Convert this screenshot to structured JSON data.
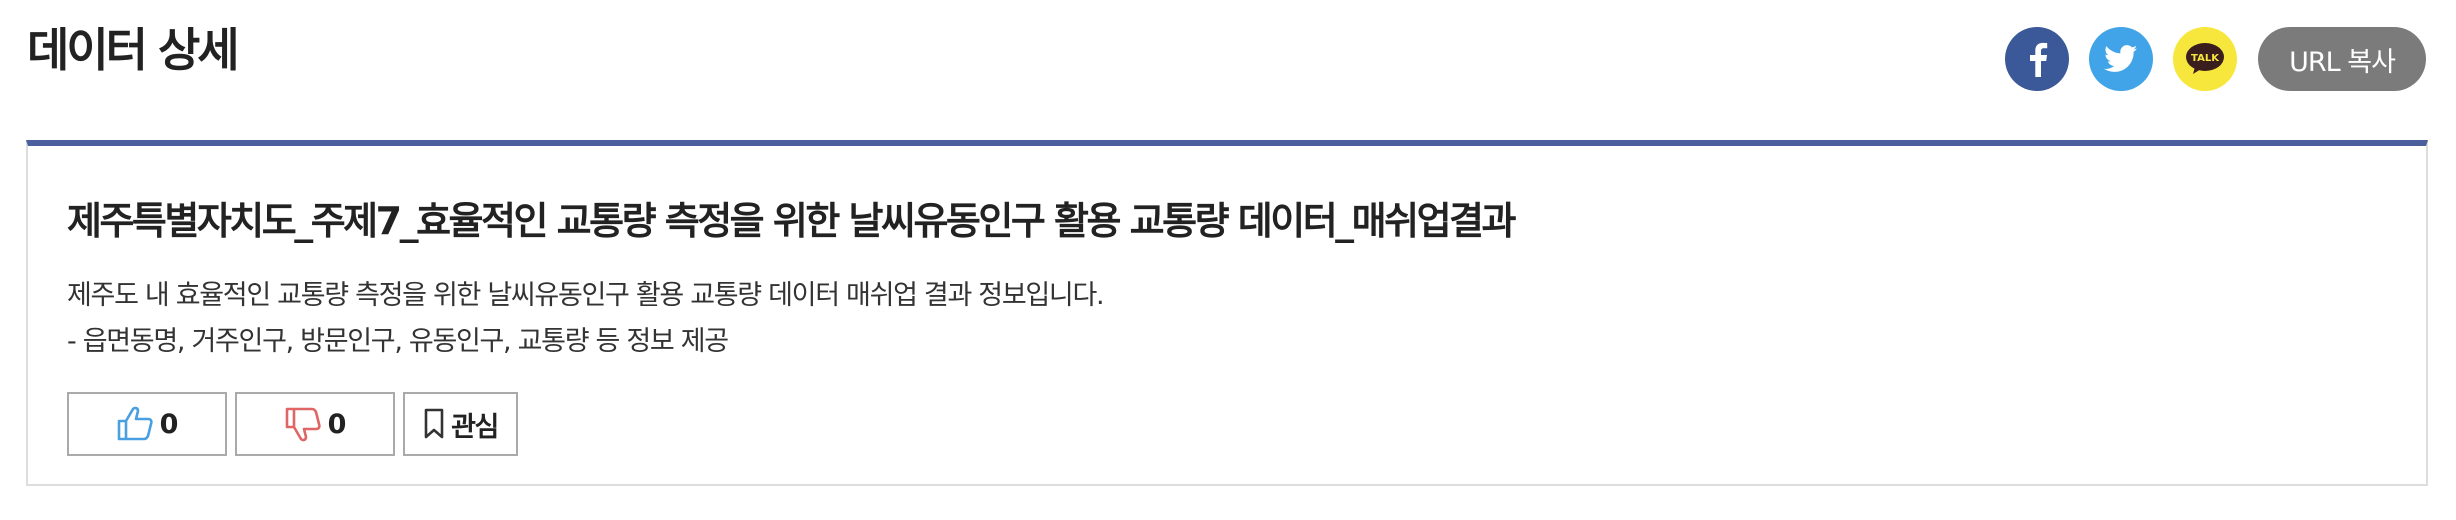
{
  "header": {
    "title": "데이터 상세"
  },
  "share": {
    "facebook_icon": "facebook-icon",
    "twitter_icon": "twitter-icon",
    "kakao_label": "TALK",
    "url_copy_label": "URL 복사"
  },
  "dataset": {
    "title": "제주특별자치도_주제7_효율적인 교통량 측정을 위한 날씨유동인구 활용 교통량 데이터_매쉬업결과",
    "description": [
      "제주도 내 효율적인 교통량 측정을 위한 날씨유동인구 활용 교통량 데이터 매쉬업 결과 정보입니다.",
      "- 읍면동명, 거주인구, 방문인구, 유동인구, 교통량 등 정보 제공"
    ]
  },
  "actions": {
    "like_count": "0",
    "dislike_count": "0",
    "favorite_label": "관심"
  },
  "colors": {
    "facebook": "#3b5998",
    "twitter": "#41a4e8",
    "kakao": "#f7e73c",
    "url_button": "#7b7b7b",
    "card_top_border": "#4a5f9b",
    "like_icon": "#4a9fe0",
    "dislike_icon": "#e06666"
  }
}
